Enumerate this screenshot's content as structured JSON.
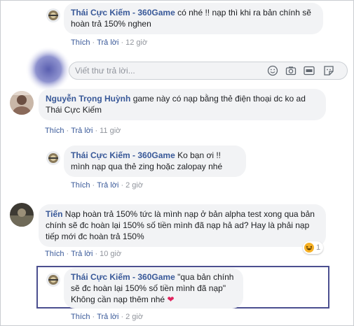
{
  "comments": [
    {
      "author": "Thái Cực Kiếm - 360Game",
      "text": "có nhé !! nạp thì khi ra bản chính sẽ hoàn trả 150% nghen",
      "like": "Thích",
      "reply": "Trả lời",
      "time": "12 giờ"
    },
    {
      "author": "Nguyễn Trọng Huỳnh",
      "text": "game này có nạp bằng thẻ điện thoại dc ko ad Thái Cực Kiếm",
      "like": "Thích",
      "reply": "Trả lời",
      "time": "11 giờ"
    },
    {
      "author": "Thái Cực Kiếm - 360Game",
      "text": "Ko bạn ơi !! mình nạp qua thẻ zing hoặc zalopay nhé",
      "like": "Thích",
      "reply": "Trả lời",
      "time": "2 giờ"
    },
    {
      "author": "Tiến",
      "text": "Nạp hoàn trả 150% tức là mình nạp ở bản alpha test xong qua bản chính sẽ đc hoàn lại 150% số tiền mình đã nạp hả ad? Hay là phải nạp tiếp mới đc hoàn trả 150%",
      "like": "Thích",
      "reply": "Trả lời",
      "time": "10 giờ",
      "reaction_count": "1"
    },
    {
      "author": "Thái Cực Kiếm - 360Game",
      "text": "\"qua bản chính sẽ đc hoàn lại 150% số tiền mình đã nạp\"",
      "text2": "Không cần nạp thêm nhé",
      "like": "Thích",
      "reply": "Trả lời",
      "time": "2 giờ"
    }
  ],
  "reply_box": {
    "placeholder": "Viết thư trả lời..."
  },
  "reply_icons": [
    "emoji-icon",
    "camera-icon",
    "gif-icon",
    "sticker-icon"
  ],
  "colors": {
    "link": "#385898",
    "meta": "#90949c",
    "bubble": "#f2f3f5",
    "highlight_border": "#4b4f8f"
  }
}
